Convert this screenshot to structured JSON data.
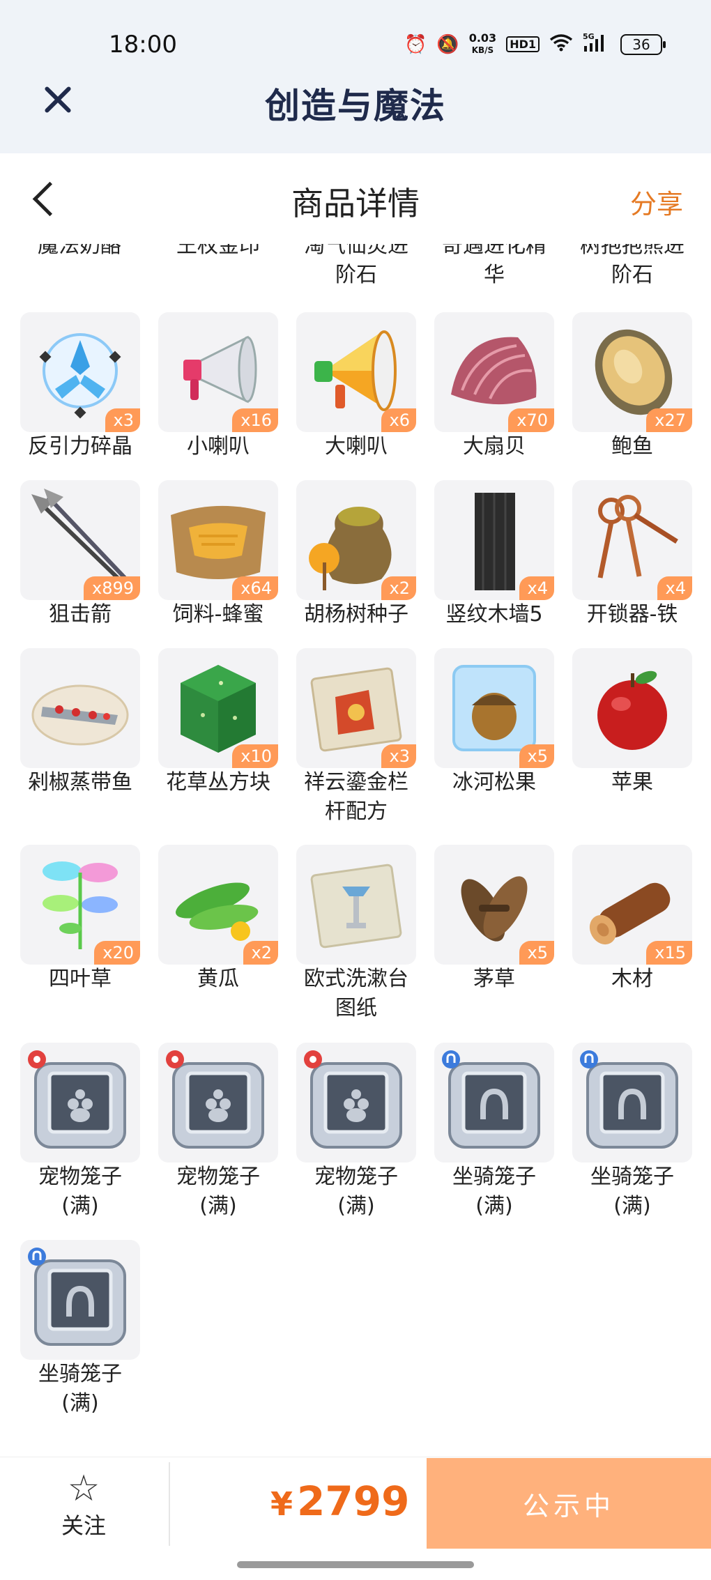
{
  "status_bar": {
    "time": "18:00",
    "speed": "0.03",
    "speed_unit": "KB/S",
    "hd": "HD1",
    "network": "5G",
    "battery": "36"
  },
  "app": {
    "title": "创造与魔法"
  },
  "page": {
    "title": "商品详情",
    "share_label": "分享"
  },
  "top_row_cut": [
    "魔法奶酪",
    "王权金印",
    "淘气仙灵进",
    "奇遇进化精",
    "树抱抱熊进"
  ],
  "top_row_second_line": [
    "",
    "",
    "阶石",
    "华",
    "阶石"
  ],
  "items": [
    {
      "name": "反引力碎晶",
      "qty": "x3",
      "icon": "crystal-icon"
    },
    {
      "name": "小喇叭",
      "qty": "x16",
      "icon": "small-megaphone-icon"
    },
    {
      "name": "大喇叭",
      "qty": "x6",
      "icon": "big-megaphone-icon"
    },
    {
      "name": "大扇贝",
      "qty": "x70",
      "icon": "scallop-icon"
    },
    {
      "name": "鲍鱼",
      "qty": "x27",
      "icon": "abalone-icon"
    },
    {
      "name": "狙击箭",
      "qty": "x899",
      "icon": "arrow-icon"
    },
    {
      "name": "饲料-蜂蜜",
      "qty": "x64",
      "icon": "honey-feed-icon"
    },
    {
      "name": "胡杨树种子",
      "qty": "x2",
      "icon": "seed-bag-icon"
    },
    {
      "name": "竖纹木墙5",
      "qty": "x4",
      "icon": "wood-wall-icon"
    },
    {
      "name": "开锁器-铁",
      "qty": "x4",
      "icon": "keys-icon"
    },
    {
      "name": "剁椒蒸带鱼",
      "qty": "",
      "icon": "fish-dish-icon"
    },
    {
      "name": "花草丛方块",
      "qty": "x10",
      "icon": "grass-block-icon"
    },
    {
      "name": "祥云鎏金栏杆配方",
      "qty": "x3",
      "icon": "scroll-recipe-icon"
    },
    {
      "name": "冰河松果",
      "qty": "x5",
      "icon": "ice-pinecone-icon"
    },
    {
      "name": "苹果",
      "qty": "",
      "icon": "apple-icon"
    },
    {
      "name": "四叶草",
      "qty": "x20",
      "icon": "clover-icon"
    },
    {
      "name": "黄瓜",
      "qty": "x2",
      "icon": "cucumber-icon"
    },
    {
      "name": "欧式洗漱台图纸",
      "qty": "",
      "icon": "blueprint-icon"
    },
    {
      "name": "茅草",
      "qty": "x5",
      "icon": "thatch-icon"
    },
    {
      "name": "木材",
      "qty": "x15",
      "icon": "log-icon"
    },
    {
      "name": "宠物笼子(满)",
      "qty": "",
      "icon": "pet-cage-icon"
    },
    {
      "name": "宠物笼子(满)",
      "qty": "",
      "icon": "pet-cage-icon"
    },
    {
      "name": "宠物笼子(满)",
      "qty": "",
      "icon": "pet-cage-icon"
    },
    {
      "name": "坐骑笼子(满)",
      "qty": "",
      "icon": "mount-cage-icon"
    },
    {
      "name": "坐骑笼子(满)",
      "qty": "",
      "icon": "mount-cage-icon"
    },
    {
      "name": "坐骑笼子(满)",
      "qty": "",
      "icon": "mount-cage-icon"
    }
  ],
  "labels": {
    "i12": [
      "祥云鎏金栏",
      "杆配方"
    ],
    "i17": [
      "欧式洗漱台",
      "图纸"
    ],
    "pet": [
      "宠物笼子",
      "(满)"
    ],
    "mount": [
      "坐骑笼子",
      "(满)"
    ]
  },
  "bottom": {
    "follow_label": "关注",
    "currency": "¥",
    "price": "2799",
    "cta_label": "公示中"
  },
  "colors": {
    "accent": "#ef6a1a",
    "cta": "#ffb17c",
    "badge": "#ff9a57",
    "header_bg": "#eff3f8"
  }
}
